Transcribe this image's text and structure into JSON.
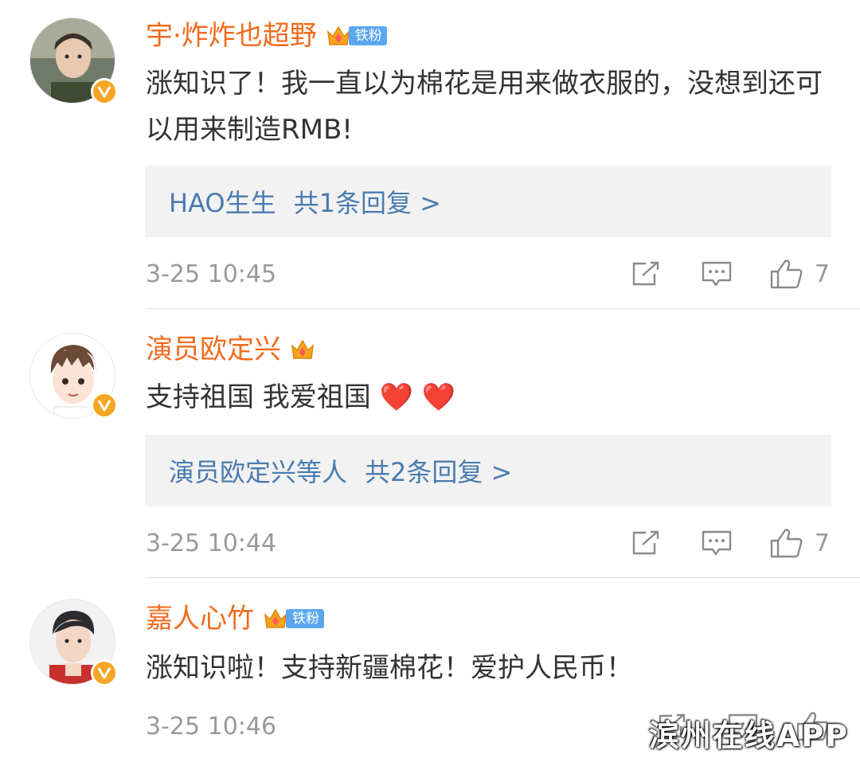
{
  "comments": [
    {
      "username": "宇·炸炸也超野",
      "fan_badge": "铁粉",
      "text": "涨知识了！我一直以为棉花是用来做衣服的，没想到还可以用来制造RMB!",
      "reply": {
        "who": "HAO生生",
        "count_text": "共1条回复 >"
      },
      "time": "3-25 10:45",
      "likes": "7"
    },
    {
      "username": "演员欧定兴",
      "fan_badge": "",
      "text": "支持祖国 我爱祖国 ❤️ ❤️",
      "reply": {
        "who": "演员欧定兴等人",
        "count_text": "共2条回复 >"
      },
      "time": "3-25 10:44",
      "likes": "7"
    },
    {
      "username": "嘉人心竹",
      "fan_badge": "铁粉",
      "text": "涨知识啦！支持新疆棉花！爱护人民币！",
      "time": "3-25 10:46"
    }
  ],
  "watermark": "滨州在线APP",
  "icons": {
    "forward": "share-edit-icon",
    "comment": "comment-icon",
    "like": "thumbs-up-icon",
    "verified": "verified-v-icon",
    "crown": "crown-badge-icon"
  },
  "colors": {
    "username": "#f26a1b",
    "reply_link": "#4a7bb0",
    "meta": "#999999",
    "fan_badge": "#5aa7f0",
    "verified": "#f6a623"
  }
}
